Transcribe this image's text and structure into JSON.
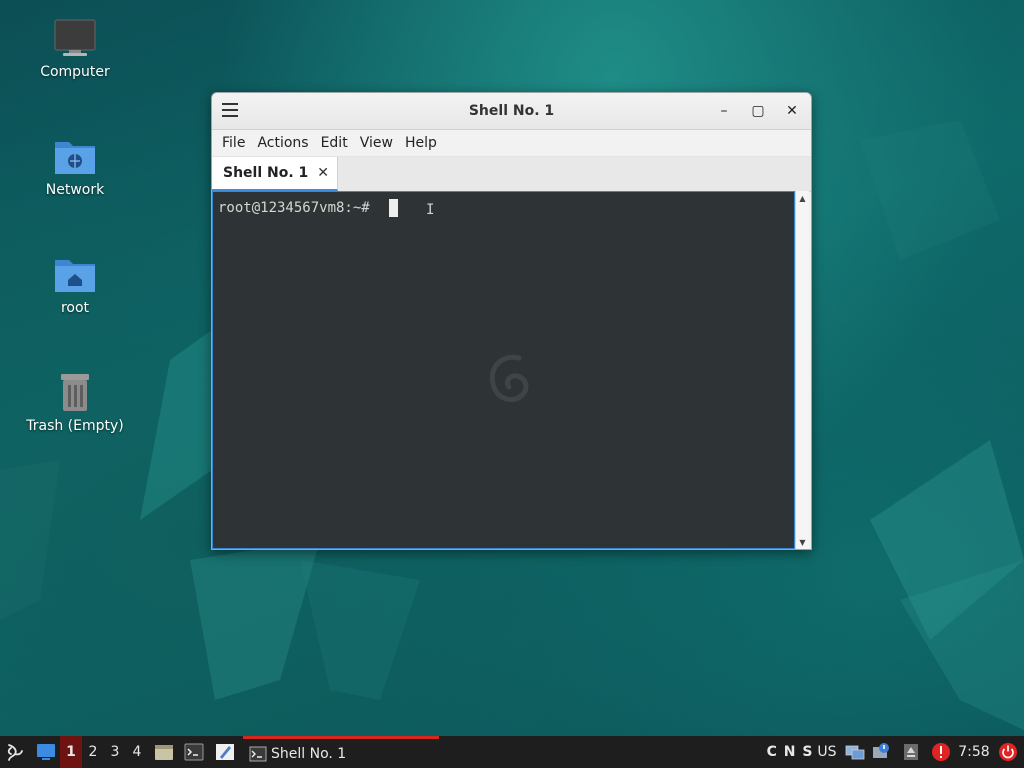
{
  "desktop": {
    "icons": [
      {
        "label": "Computer",
        "icon": "computer-icon"
      },
      {
        "label": "Network",
        "icon": "network-folder-icon"
      },
      {
        "label": "root",
        "icon": "home-folder-icon"
      },
      {
        "label": "Trash (Empty)",
        "icon": "trash-icon"
      }
    ]
  },
  "window": {
    "title": "Shell No. 1",
    "menu": [
      "File",
      "Actions",
      "Edit",
      "View",
      "Help"
    ],
    "tab": {
      "label": "Shell No. 1",
      "close": "✕"
    },
    "terminal": {
      "prompt": "root@1234567vm8:~#",
      "ibeam": "I"
    },
    "controls": {
      "minimize": "–",
      "maximize": "▢",
      "close": "✕"
    }
  },
  "taskbar": {
    "workspaces": [
      "1",
      "2",
      "3",
      "4"
    ],
    "active_workspace": "1",
    "task": {
      "label": "Shell No. 1"
    },
    "tray": {
      "indicators": "C N S",
      "layout": "US",
      "clock": "7:58"
    }
  },
  "colors": {
    "accent": "#d9261c",
    "selection": "#3a87d6",
    "terminal_bg": "#2e3436"
  }
}
